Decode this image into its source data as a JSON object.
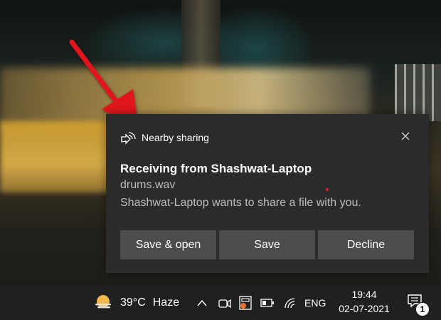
{
  "notification": {
    "app_name": "Nearby sharing",
    "title": "Receiving from Shashwat-Laptop",
    "file_name": "drums.wav",
    "message": "Shashwat-Laptop wants to share a file with you.",
    "actions": [
      "Save & open",
      "Save",
      "Decline"
    ]
  },
  "taskbar": {
    "weather_temp": "39°C",
    "weather_condition": "Haze",
    "language": "ENG",
    "time": "19:44",
    "date": "02-07-2021",
    "notification_count": "1"
  },
  "colors": {
    "toast_background": "#2b2b2b",
    "button_background": "#4c4c4c",
    "taskbar_background": "#202020",
    "arrow": "#e0151d"
  }
}
